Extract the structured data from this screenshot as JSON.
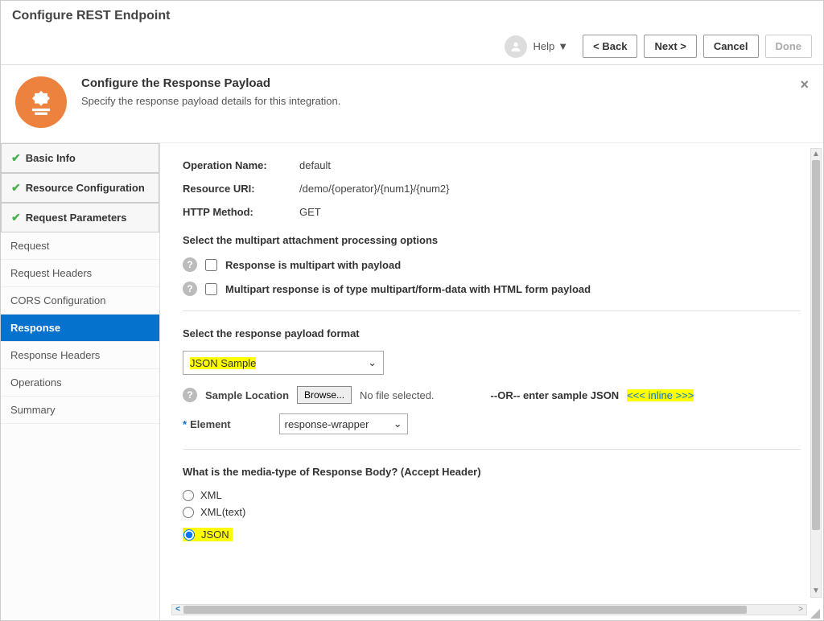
{
  "window_title": "Configure REST Endpoint",
  "toolbar": {
    "help": "Help",
    "back": "<  Back",
    "next": "Next  >",
    "cancel": "Cancel",
    "done": "Done"
  },
  "hero": {
    "title": "Configure the Response Payload",
    "subtitle": "Specify the response payload details for this integration."
  },
  "sidebar": {
    "basic_info": "Basic Info",
    "resource_config": "Resource Configuration",
    "request_params": "Request Parameters",
    "request": "Request",
    "request_headers": "Request Headers",
    "cors": "CORS Configuration",
    "response": "Response",
    "response_headers": "Response Headers",
    "operations": "Operations",
    "summary": "Summary"
  },
  "summary": {
    "op_name_label": "Operation Name:",
    "op_name": "default",
    "uri_label": "Resource URI:",
    "uri": "/demo/{operator}/{num1}/{num2}",
    "method_label": "HTTP Method:",
    "method": "GET"
  },
  "multipart": {
    "section": "Select the multipart attachment processing options",
    "opt1": "Response is multipart with payload",
    "opt2": "Multipart response is of type multipart/form-data with HTML form payload"
  },
  "payload": {
    "section": "Select the response payload format",
    "format_selected": "JSON Sample",
    "sample_location_label": "Sample Location",
    "browse": "Browse...",
    "no_file": "No file selected.",
    "or_text": "--OR-- enter sample JSON",
    "inline_link": "<<< inline >>>",
    "element_label": "Element",
    "element_value": "response-wrapper"
  },
  "media": {
    "section": "What is the media-type of Response Body? (Accept Header)",
    "xml": "XML",
    "xml_text": "XML(text)",
    "json": "JSON"
  }
}
